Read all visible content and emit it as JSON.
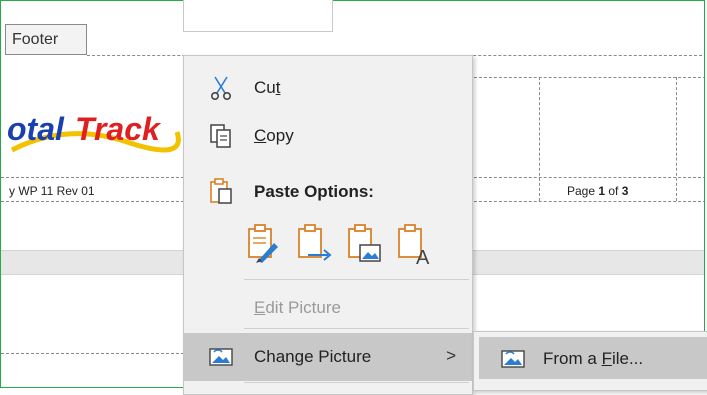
{
  "document": {
    "footer_tab": "Footer",
    "logo_text_part1": "otal",
    "logo_text_part2": "Track",
    "revision": "y WP 11 Rev 01",
    "page_prefix": "Page ",
    "page_current": "1",
    "page_mid": " of ",
    "page_total": "3"
  },
  "context_menu": {
    "cut": {
      "pre": "Cu",
      "key": "t",
      "post": ""
    },
    "copy": {
      "pre": "",
      "key": "C",
      "post": "opy"
    },
    "paste_options": "Paste Options:",
    "edit_picture": {
      "pre": "",
      "key": "E",
      "post": "dit Picture"
    },
    "change_picture": {
      "pre": "Chan",
      "key": "g",
      "post": "e Picture"
    },
    "arrow": ">"
  },
  "submenu": {
    "from_file": {
      "pre": "From a ",
      "key": "F",
      "post": "ile..."
    }
  },
  "colors": {
    "frame_border": "#2aa84a",
    "menu_bg": "#f1f1f1",
    "highlight": "#c8c8c8",
    "icon_orange": "#d9822b",
    "icon_blue": "#2b7cd3",
    "logo_red": "#e02020",
    "logo_blue": "#1a3fb0"
  },
  "icons": [
    "scissors-icon",
    "copy-icon",
    "paste-icon",
    "paste-keep-formatting-icon",
    "paste-merge-icon",
    "paste-picture-icon",
    "paste-text-only-icon",
    "change-picture-icon",
    "from-file-icon"
  ]
}
